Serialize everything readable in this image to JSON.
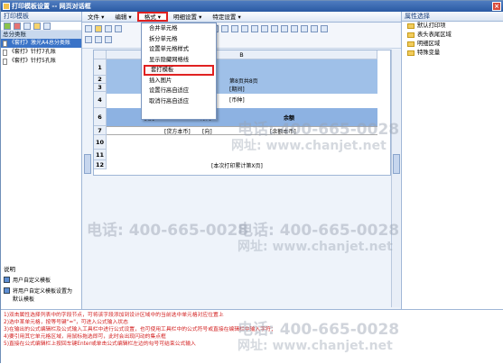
{
  "window": {
    "title": "打印模板设置 -- 网页对话框",
    "close_label": "×"
  },
  "left": {
    "panel_title": "打印模板",
    "tree_head": "总分类账",
    "templates": [
      "《套打》激光A4总分类账",
      "《套打》针打7孔账",
      "《套打》针打5孔账"
    ],
    "description_title": "说明",
    "descriptions": [
      "用户自定义模板",
      "将用户自定义模板设置为默认模板"
    ]
  },
  "menubar": {
    "items": [
      "文件 ▾",
      "编辑 ▾",
      "格式 ▾",
      "明细设置 ▾",
      "特定设置 ▾"
    ]
  },
  "dropdown": {
    "items": [
      "合并单元格",
      "拆分单元格",
      "设置单元格样式",
      "显示隐藏网格线",
      "套打模板",
      "插入图片",
      "设置行高自适应",
      "取消行高自适应"
    ],
    "highlighted_index": 4
  },
  "sheet": {
    "col_head_b": "B",
    "rows": [
      "1",
      "2",
      "3",
      "4",
      "6",
      "7",
      "10",
      "11",
      "12"
    ],
    "cells": {
      "page_info": "第8页共8页",
      "date": "[期间]",
      "currency": "[币种]",
      "lender": "贷方",
      "direction": "方向",
      "balance": "余额",
      "credit_amount": "[贷方本币]",
      "dir_field": "[向]",
      "balance_amount": "[余额本币]",
      "footer": "[本次打印累计第X页]"
    }
  },
  "right": {
    "panel_title": "属性选择",
    "items": [
      "默认打印项",
      "表头表尾区域",
      "明细区域",
      "特殊变量"
    ]
  },
  "notes": [
    "1)双击属性选择列表中的字段节点，可将该字段添加到设计区域中的当前选中单元格对应位置上",
    "2)选中某单元格，按等号键\"=\"，可进入公式输入状态",
    "3)在输出的公式编辑栏及公式输入工具栏中进行公式设置，也可使用工具栏中的公式符号或直接在编辑栏中输入字符；",
    "4)要引用其它单元格区域，用鼠标拖选即可，此时会出现闪动的集点框",
    "5)直接在公式编辑栏上按回车键Enter或单击公式编辑栏左边的勾号可结束公式输入"
  ],
  "watermark": {
    "phone": "电话: 400-665-0028",
    "site": "网址: www.chanjet.net"
  }
}
